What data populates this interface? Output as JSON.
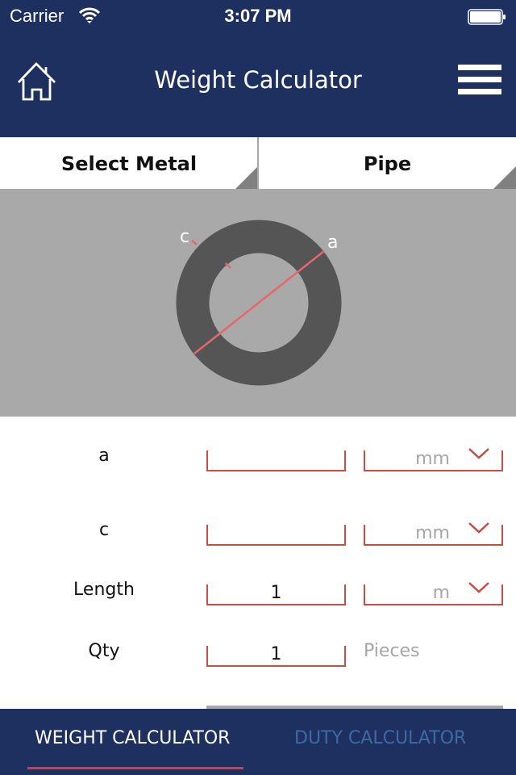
{
  "status_bar": {
    "carrier": "Carrier",
    "time": "3:07 PM",
    "wifi_icon": "wifi-icon",
    "battery_icon": "battery-full-icon"
  },
  "header": {
    "title": "Weight Calculator",
    "home_icon": "home-icon",
    "menu_icon": "hamburger-menu-icon"
  },
  "selectors": {
    "metal": "Select Metal",
    "shape": "Pipe"
  },
  "diagram": {
    "label_outer": "a",
    "label_thickness": "c",
    "ring_color": "#555555",
    "line_color": "#e8666b"
  },
  "form": {
    "fields": [
      {
        "label": "a",
        "value": "",
        "unit": "mm"
      },
      {
        "label": "c",
        "value": "",
        "unit": "mm"
      },
      {
        "label": "Length",
        "value": "1",
        "unit": "m"
      },
      {
        "label": "Qty",
        "value": "1",
        "unit_text": "Pieces"
      }
    ]
  },
  "tabs": [
    {
      "label": "WEIGHT CALCULATOR",
      "active": true
    },
    {
      "label": "DUTY CALCULATOR",
      "active": false
    }
  ],
  "colors": {
    "brand_navy": "#1e3060",
    "accent_red": "#c94c45",
    "tab_underline": "#b5485d",
    "inactive_tab": "#3d6aa3"
  }
}
